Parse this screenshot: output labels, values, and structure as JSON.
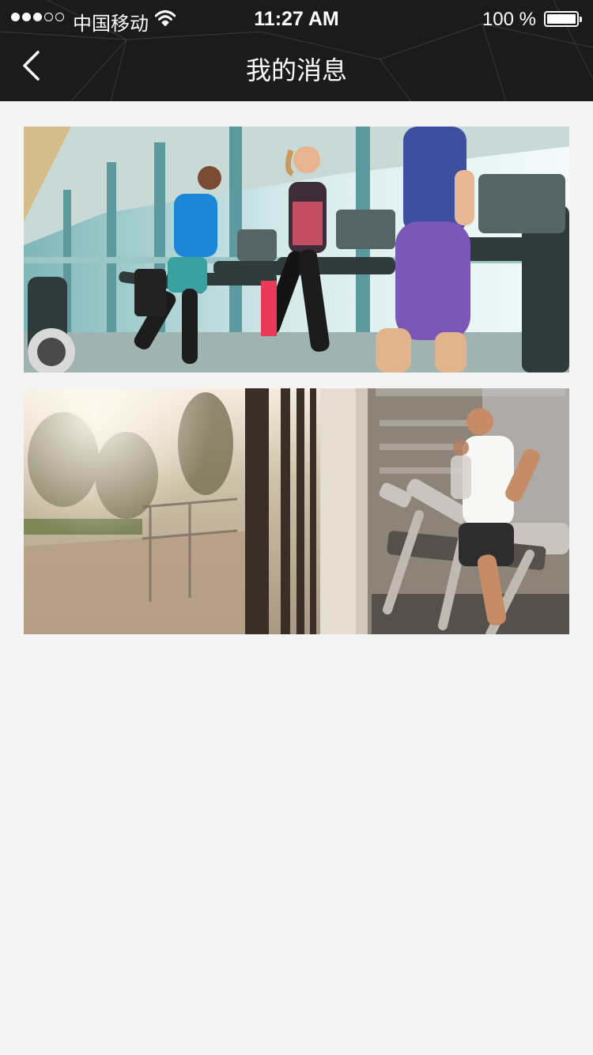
{
  "status_bar": {
    "carrier": "中国移动",
    "time": "11:27 AM",
    "battery_text": "100 %",
    "signal_strength": 3,
    "battery_level": 1.0
  },
  "nav": {
    "title": "我的消息",
    "back_icon": "chevron-left-icon"
  },
  "colors": {
    "header_bg": "#1b1b1b",
    "page_bg": "#f4f4f4",
    "header_text": "#ffffff"
  },
  "messages": [
    {
      "image": "gym-treadmill-runners-photo"
    },
    {
      "image": "gym-window-treadmill-photo"
    }
  ]
}
